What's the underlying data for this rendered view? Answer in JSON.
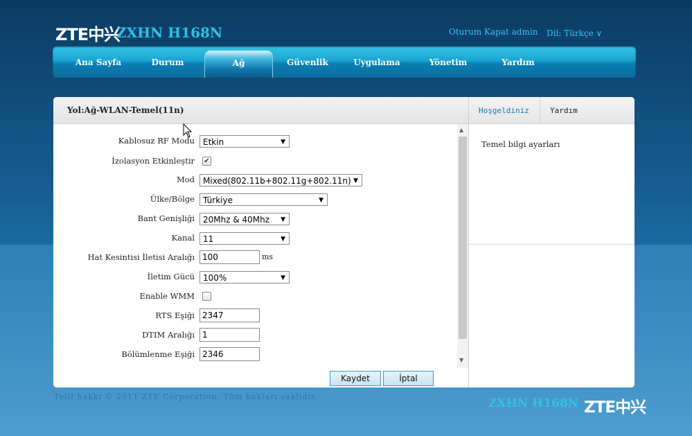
{
  "brand": {
    "logo_text": "ZTE中兴",
    "model": "ZXHN H168N"
  },
  "header": {
    "logout": "Oturum Kapat",
    "user": "admin",
    "language": "Dil: Türkçe",
    "language_caret": "∨"
  },
  "nav": {
    "items": [
      "Ana Sayfa",
      "Durum",
      "Ağ",
      "Güvenlik",
      "Uygulama",
      "Yönetim",
      "Yardım"
    ],
    "active": "Ağ"
  },
  "breadcrumb": "Yol:Ağ-WLAN-Temel(11n)",
  "side_tabs": {
    "welcome": "Hoşgeldiniz",
    "help": "Yardım"
  },
  "side_panel": {
    "text": "Temel bilgi ayarları"
  },
  "form": {
    "rf_mode": {
      "label": "Kablosuz RF Modu",
      "value": "Etkin"
    },
    "isolation": {
      "label": "İzolasyon Etkinleştir",
      "checked": true,
      "check_glyph": "✔"
    },
    "mode": {
      "label": "Mod",
      "value": "Mixed(802.11b+802.11g+802.11n)"
    },
    "country": {
      "label": "Ülke/Bölge",
      "value": "Türkiye"
    },
    "bandwidth": {
      "label": "Bant Genişliği",
      "value": "20Mhz & 40Mhz"
    },
    "channel": {
      "label": "Kanal",
      "value": "11"
    },
    "beacon": {
      "label": "Hat Kesintisi İletisi Aralığı",
      "value": "100",
      "unit": "ms"
    },
    "tx_power": {
      "label": "İletim Gücü",
      "value": "100%"
    },
    "wmm": {
      "label": "Enable WMM",
      "checked": false
    },
    "rts": {
      "label": "RTS Eşiği",
      "value": "2347"
    },
    "dtim": {
      "label": "DTIM Aralığı",
      "value": "1"
    },
    "fragment": {
      "label": "Bölümlenme Eşiği",
      "value": "2346"
    }
  },
  "buttons": {
    "save": "Kaydet",
    "cancel": "İptal"
  },
  "footer": {
    "copyright": "Telif hakkı © 2011 ZTE Corporation. Tüm hakları saklıdır.",
    "model": "ZXHN H168N",
    "logo_text": "ZTE中兴"
  },
  "glyphs": {
    "select_arrow": "▼",
    "scroll_up": "▲",
    "scroll_down": "▼"
  },
  "colors": {
    "accent": "#2fc1e6",
    "nav_gradient_top": "#35c3e5",
    "nav_gradient_bottom": "#0b6c9c",
    "background_top": "#0b3b63"
  }
}
